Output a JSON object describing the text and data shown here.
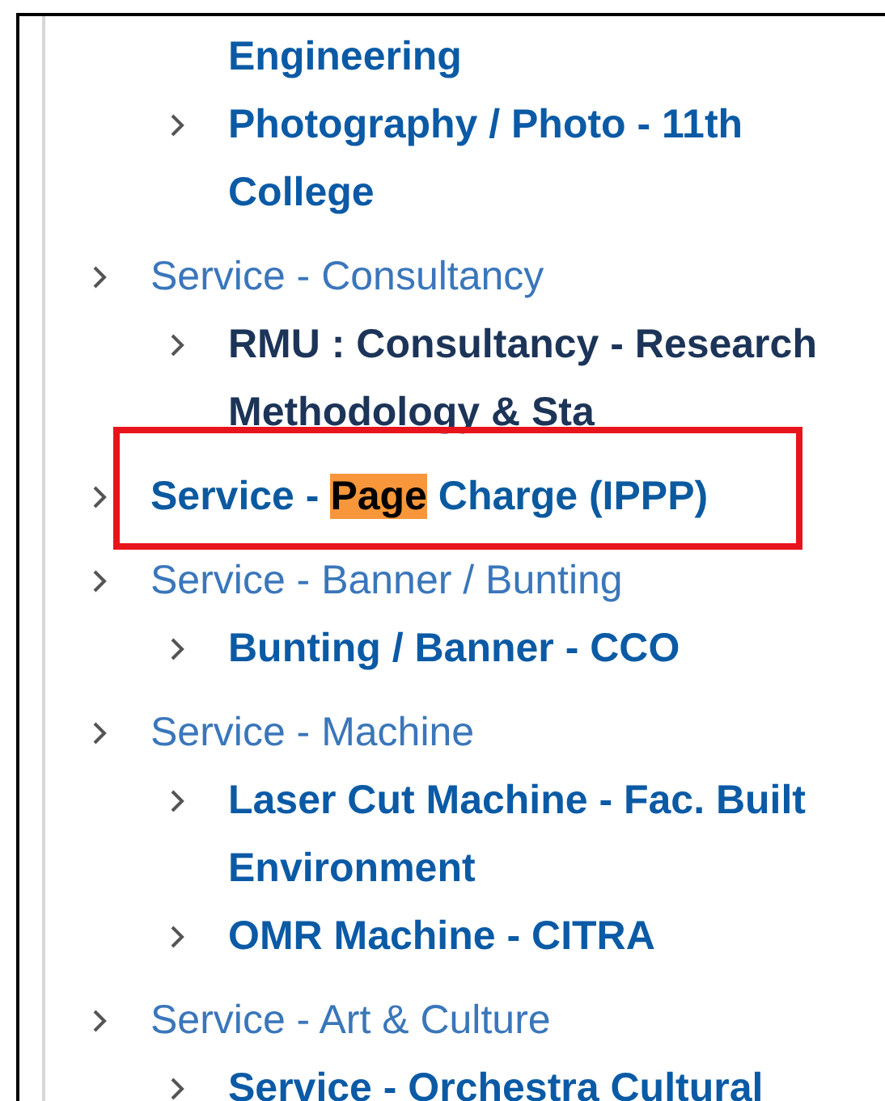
{
  "orphan_children": [
    {
      "kind": "continuation",
      "label": "Engineering",
      "visited": false
    },
    {
      "kind": "item",
      "label": "Photography / Photo - 11th College",
      "visited": false
    }
  ],
  "items": [
    {
      "label_parts": [
        {
          "text": "Service - Consultancy",
          "highlighted": false
        }
      ],
      "selected": false,
      "boxed": false,
      "children": [
        {
          "kind": "item",
          "label": "RMU : Consultancy - Research Methodology & Sta",
          "visited": true
        }
      ]
    },
    {
      "label_parts": [
        {
          "text": "Service - ",
          "highlighted": false
        },
        {
          "text": "Page",
          "highlighted": true
        },
        {
          "text": " Charge (IPPP)",
          "highlighted": false
        }
      ],
      "selected": true,
      "boxed": true
    },
    {
      "label_parts": [
        {
          "text": "Service - Banner / Bunting",
          "highlighted": false
        }
      ],
      "selected": false,
      "boxed": false,
      "children": [
        {
          "kind": "item",
          "label": "Bunting / Banner - CCO",
          "visited": false
        }
      ]
    },
    {
      "label_parts": [
        {
          "text": "Service - Machine",
          "highlighted": false
        }
      ],
      "selected": false,
      "boxed": false,
      "children": [
        {
          "kind": "item",
          "label": "Laser Cut Machine - Fac. Built Environment",
          "visited": false
        },
        {
          "kind": "item",
          "label": "OMR Machine - CITRA",
          "visited": false
        }
      ]
    },
    {
      "label_parts": [
        {
          "text": "Service - Art & Culture",
          "highlighted": false
        }
      ],
      "selected": false,
      "boxed": false,
      "children": [
        {
          "kind": "item",
          "label": "Service - Orchestra Cultural",
          "visited": false
        }
      ]
    }
  ]
}
